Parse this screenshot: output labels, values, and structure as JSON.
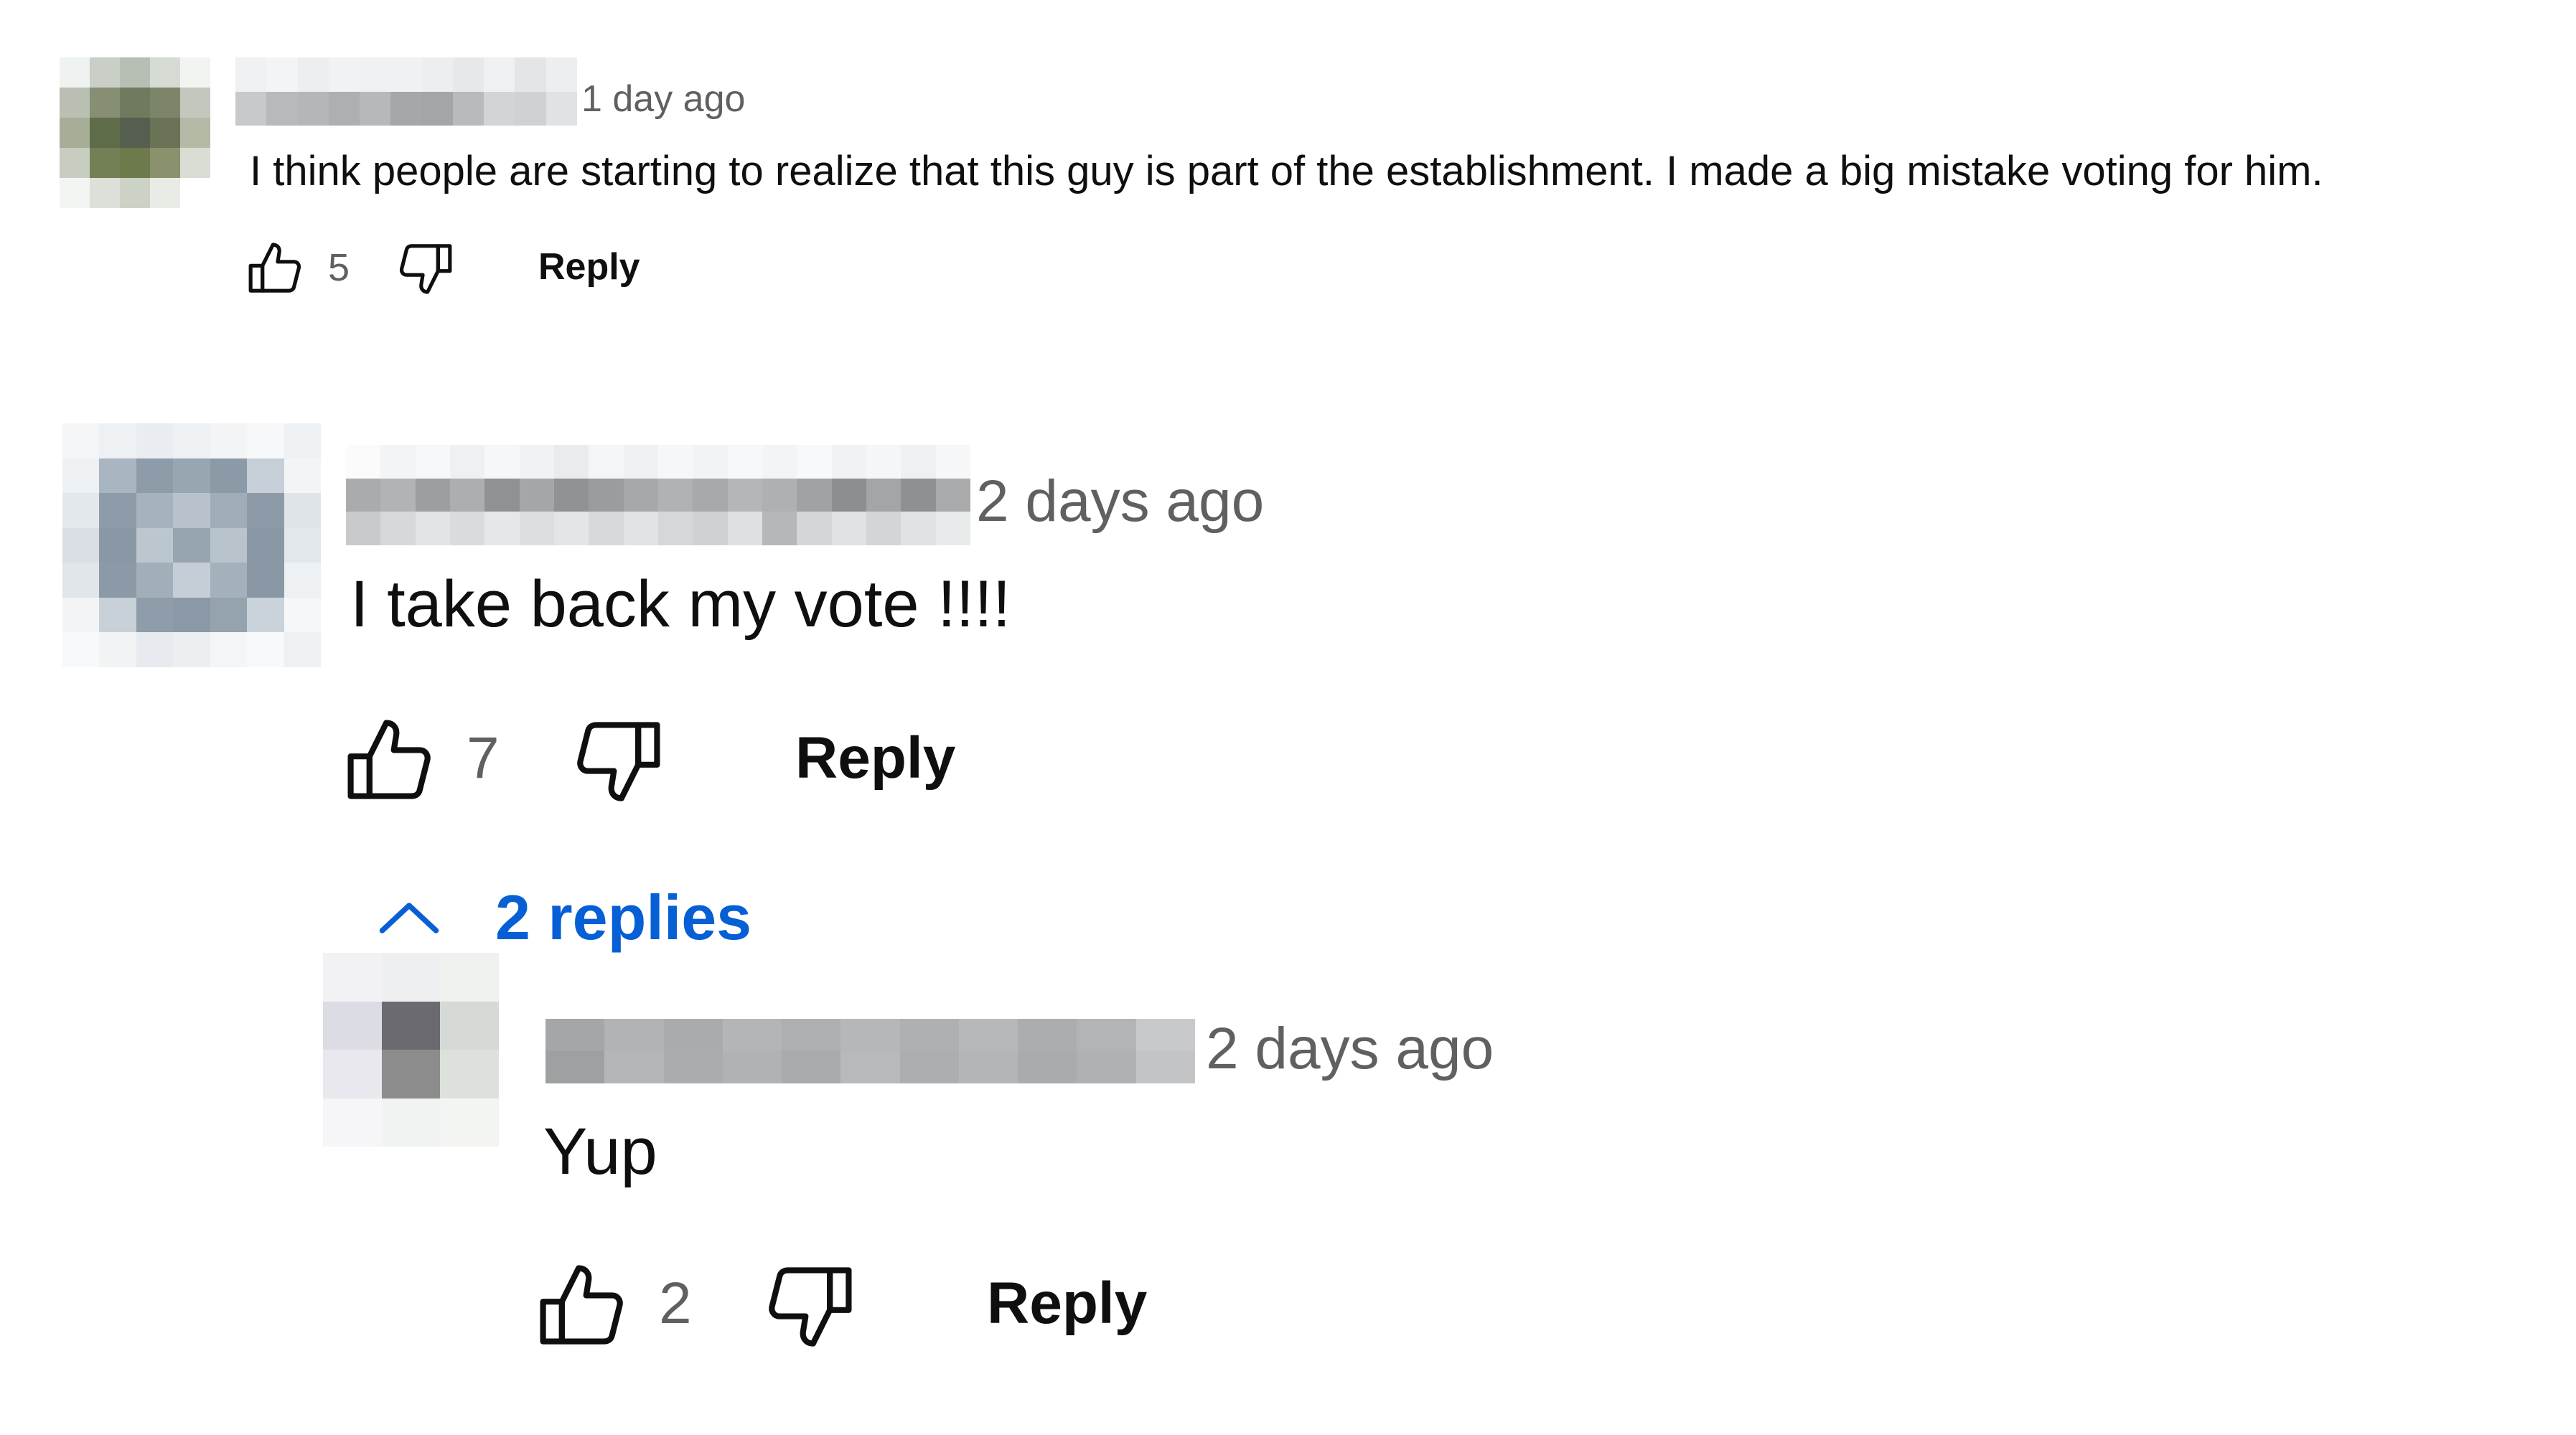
{
  "comments": [
    {
      "timestamp": "1 day ago",
      "text": "I think people are starting to realize that this guy is part of the establishment. I made a big mistake voting for him.",
      "likes": "5",
      "reply_label": "Reply"
    },
    {
      "timestamp": "2 days ago",
      "text": "I take back my vote !!!!",
      "likes": "7",
      "reply_label": "Reply",
      "replies_toggle": "2 replies",
      "replies": [
        {
          "timestamp": "2 days ago",
          "text": "Yup",
          "likes": "2",
          "reply_label": "Reply"
        }
      ]
    }
  ],
  "icons": {
    "like": "thumbs-up-icon",
    "dislike": "thumbs-down-icon",
    "collapse": "chevron-up-icon"
  },
  "colors": {
    "link_blue": "#065fd4",
    "meta_gray": "#606060",
    "text": "#0f0f0f"
  }
}
